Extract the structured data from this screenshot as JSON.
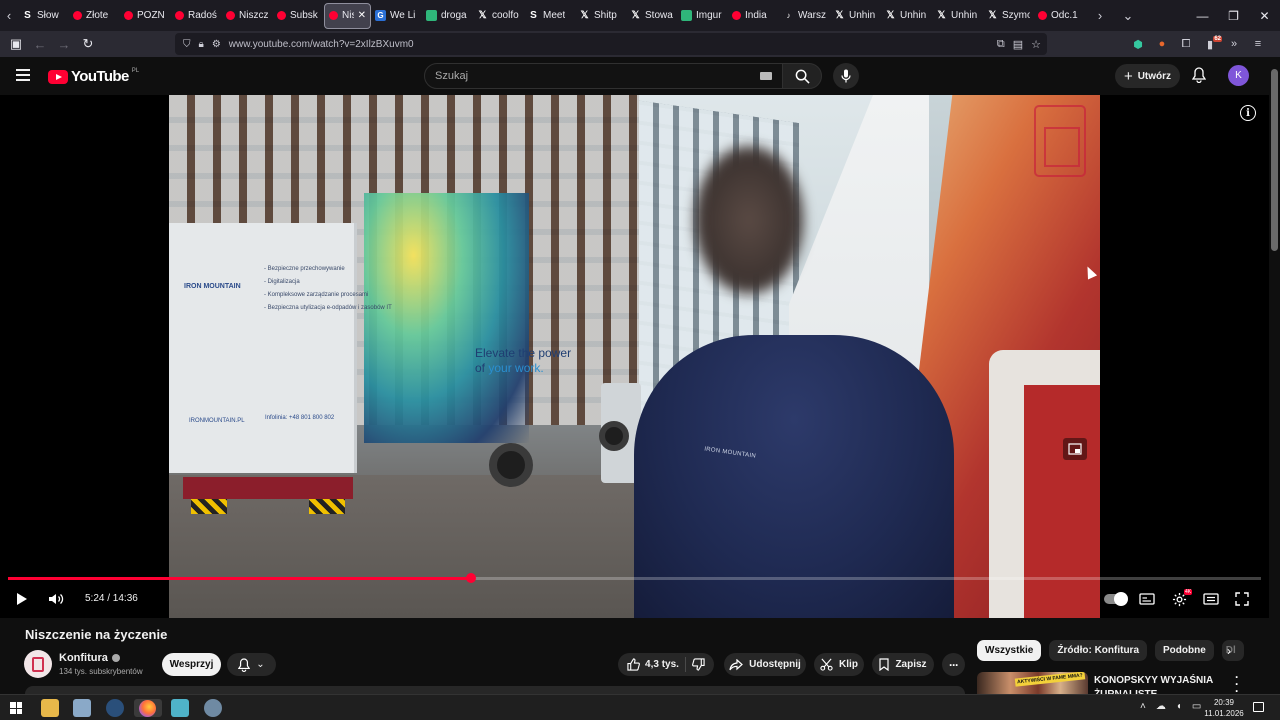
{
  "browser": {
    "tabs": [
      {
        "label": "Słow",
        "icon": "dot-icon",
        "fav": "s"
      },
      {
        "label": "Złote",
        "icon": "youtube-icon",
        "fav": "yt"
      },
      {
        "label": "POZN",
        "icon": "youtube-icon",
        "fav": "yt"
      },
      {
        "label": "Radoś",
        "icon": "youtube-icon",
        "fav": "yt"
      },
      {
        "label": "Niszcz",
        "icon": "youtube-icon",
        "fav": "yt"
      },
      {
        "label": "Subsk",
        "icon": "youtube-icon",
        "fav": "yt"
      },
      {
        "label": "Nis",
        "icon": "youtube-icon",
        "fav": "yt",
        "active": true
      },
      {
        "label": "We Li",
        "icon": "gif-icon",
        "fav": "blue"
      },
      {
        "label": "droga",
        "icon": "chatgpt-icon",
        "fav": "green"
      },
      {
        "label": "coolfo",
        "icon": "x-icon",
        "fav": "x"
      },
      {
        "label": "Meet",
        "icon": "s-icon",
        "fav": "s"
      },
      {
        "label": "Shitp",
        "icon": "x-icon",
        "fav": "x"
      },
      {
        "label": "Stowa",
        "icon": "x-icon",
        "fav": "x"
      },
      {
        "label": "Imgur",
        "icon": "chatgpt-icon",
        "fav": "green"
      },
      {
        "label": "India",
        "icon": "youtube-icon",
        "fav": "yt"
      },
      {
        "label": "Warsz",
        "icon": "tiktok-icon",
        "fav": "tk"
      },
      {
        "label": "Unhin",
        "icon": "x-icon",
        "fav": "x"
      },
      {
        "label": "Unhin",
        "icon": "x-icon",
        "fav": "x"
      },
      {
        "label": "Unhin",
        "icon": "x-icon",
        "fav": "x"
      },
      {
        "label": "Szymo",
        "icon": "x-icon",
        "fav": "x"
      },
      {
        "label": "Odc.1",
        "icon": "youtube-icon",
        "fav": "yt"
      }
    ],
    "url": "www.youtube.com/watch?v=2xIlzBXuvm0",
    "extension_badge": "62"
  },
  "youtube": {
    "logo_text": "YouTube",
    "country_code": "PL",
    "search_placeholder": "Szukaj",
    "create_label": "Utwórz",
    "avatar_letter": "K"
  },
  "player": {
    "time_label": "5:24 / 14:36",
    "progress_fraction": 0.3699,
    "video_texts": {
      "tagline_1": "Elevate the power",
      "tagline_2a": "of",
      "tagline_2b": "your work.",
      "truck_brand": "IRON MOUNTAIN",
      "truck_services": [
        "- Bezpieczne przechowywanie",
        "- Digitalizacja",
        "- Kompleksowe zarządzanie procesami",
        "- Bezpieczna utylizacja e-odpadów i zasobów IT"
      ],
      "truck_web": "IRONMOUNTAIN.PL",
      "truck_phone": "Infolinia: +48 801 800 802",
      "jacket_brand": "IRON MOUNTAIN"
    }
  },
  "video": {
    "title": "Niszczenie na życzenie",
    "channel_name": "Konfitura",
    "subscribers": "134 tys. subskrybentów",
    "support_label": "Wesprzyj",
    "likes": "4,3 tys.",
    "share_label": "Udostępnij",
    "clip_label": "Klip",
    "save_label": "Zapisz"
  },
  "sidebar": {
    "chips": [
      "Wszystkie",
      "Źródło: Konfitura",
      "Podobne",
      "Dl"
    ],
    "recommendation": {
      "title": "KONOPSKYY WYJAŚNIA ŻURNALISTĘ",
      "thumb_tag": "AKTYWIŚCI W FAME MMA?"
    }
  },
  "taskbar": {
    "time": "20:39",
    "date": "11.01.2026"
  }
}
